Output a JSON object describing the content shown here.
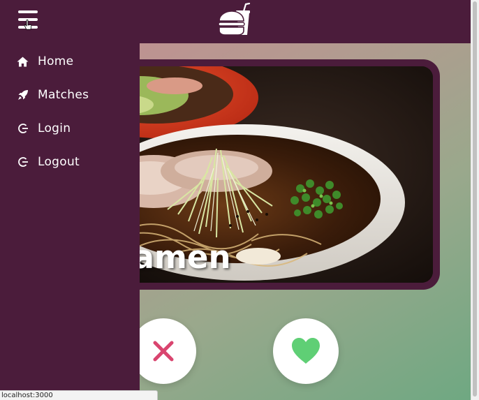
{
  "topbar": {
    "menu_icon": "hamburger-menu-icon",
    "logo_icon": "burger-and-drink-icon",
    "background": "#4b1c3b"
  },
  "sidebar": {
    "background": "#4b1c3b",
    "items": [
      {
        "label": "Home",
        "icon": "home-icon"
      },
      {
        "label": "Matches",
        "icon": "rocket-icon"
      },
      {
        "label": "Login",
        "icon": "login-icon"
      },
      {
        "label": "Logout",
        "icon": "logout-icon"
      }
    ]
  },
  "card": {
    "title": "Ramen",
    "visible_title": "ki Ramen",
    "border_color": "#4b1c3b"
  },
  "actions": {
    "dislike_icon": "close-icon",
    "dislike_color": "#d9456f",
    "like_icon": "heart-icon",
    "like_color": "#5fcf75"
  },
  "status_bar": {
    "url": "localhost:3000"
  }
}
